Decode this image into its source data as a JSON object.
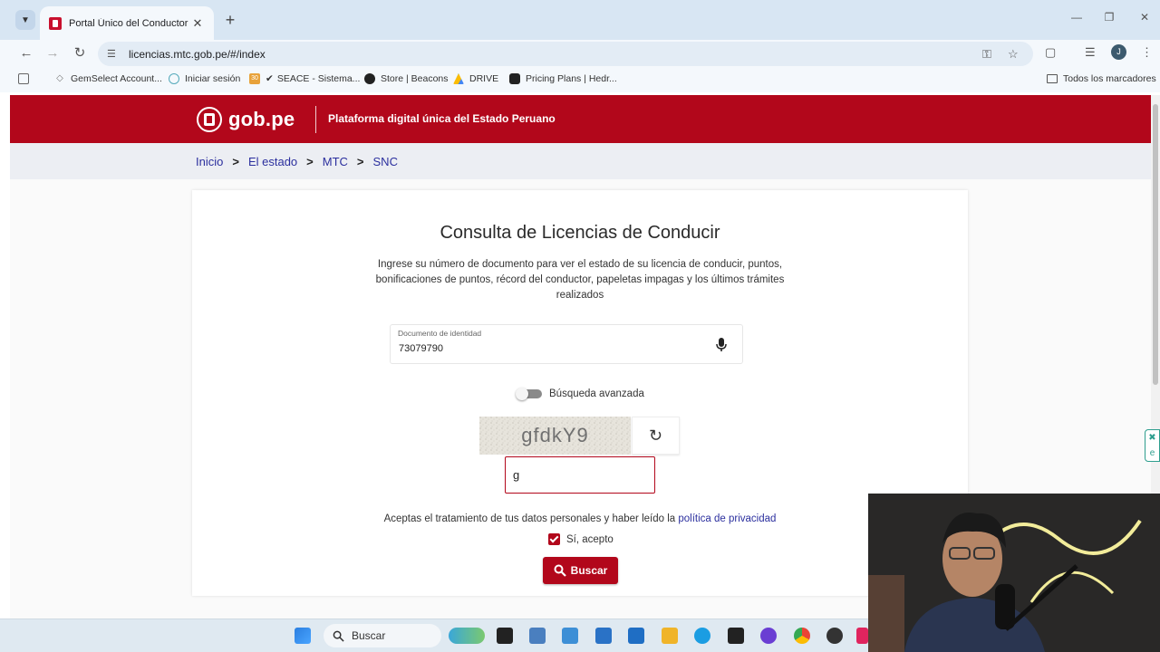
{
  "browser": {
    "tab_title": "Portal Único del Conductor",
    "url": "licencias.mtc.gob.pe/#/index",
    "profile_initial": "J",
    "bookmarks": [
      {
        "label": "GemSelect Account...",
        "icon": "gem-icon"
      },
      {
        "label": "Iniciar sesión",
        "icon": "login-icon"
      },
      {
        "label": "SEACE - Sistema...",
        "icon": "seace-icon"
      },
      {
        "label": "Store | Beacons",
        "icon": "beacons-icon"
      },
      {
        "label": "DRIVE",
        "icon": "drive-icon"
      },
      {
        "label": "Pricing Plans | Hedr...",
        "icon": "hedra-icon"
      }
    ],
    "all_bookmarks_label": "Todos los marcadores"
  },
  "header": {
    "logo_text": "gob.pe",
    "tagline": "Plataforma digital única del Estado Peruano",
    "brand_color": "#b2071b"
  },
  "breadcrumb": {
    "items": [
      "Inicio",
      "El estado",
      "MTC",
      "SNC"
    ],
    "separator": ">"
  },
  "form": {
    "title": "Consulta de Licencias de Conducir",
    "description": "Ingrese su número de documento para ver el estado de su licencia de conducir, puntos, bonificaciones de puntos, récord del conductor, papeletas impagas y los últimos trámites realizados",
    "document_label": "Documento de identidad",
    "document_value": "73079790",
    "advanced_search_label": "Búsqueda avanzada",
    "captcha_text": "gfdkY9",
    "captcha_input_value": "g",
    "privacy_prefix": "Aceptas el tratamiento de tus datos personales y haber leído la",
    "privacy_link": "política de privacidad",
    "accept_label": "Sí, acepto",
    "search_button": "Buscar"
  },
  "taskbar": {
    "search_placeholder": "Buscar"
  }
}
